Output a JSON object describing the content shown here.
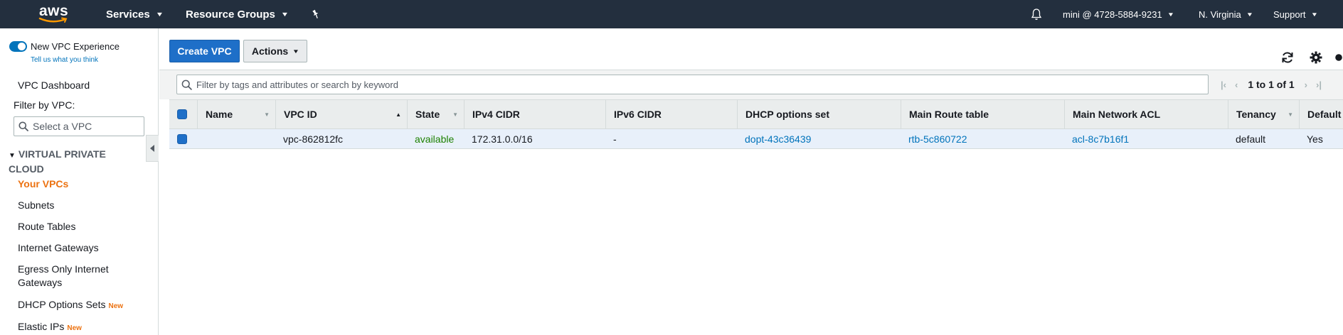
{
  "topnav": {
    "logo_text": "aws",
    "services_label": "Services",
    "resource_groups_label": "Resource Groups",
    "account_label": "mini @ 4728-5884-9231",
    "region_label": "N. Virginia",
    "support_label": "Support"
  },
  "sidebar": {
    "toggle_label": "New VPC Experience",
    "feedback_label": "Tell us what you think",
    "dashboard_label": "VPC Dashboard",
    "filter_label": "Filter by VPC:",
    "filter_placeholder": "Select a VPC",
    "section_title": "VIRTUAL PRIVATE CLOUD",
    "items": [
      {
        "label": "Your VPCs",
        "active": true,
        "badge": ""
      },
      {
        "label": "Subnets",
        "active": false,
        "badge": ""
      },
      {
        "label": "Route Tables",
        "active": false,
        "badge": ""
      },
      {
        "label": "Internet Gateways",
        "active": false,
        "badge": ""
      },
      {
        "label": "Egress Only Internet Gateways",
        "active": false,
        "badge": ""
      },
      {
        "label": "DHCP Options Sets",
        "active": false,
        "badge": "New"
      },
      {
        "label": "Elastic IPs",
        "active": false,
        "badge": "New"
      }
    ]
  },
  "toolbar": {
    "create_label": "Create VPC",
    "actions_label": "Actions"
  },
  "filter": {
    "placeholder": "Filter by tags and attributes or search by keyword",
    "pagination": "1 to 1 of 1"
  },
  "table": {
    "columns": [
      "Name",
      "VPC ID",
      "State",
      "IPv4 CIDR",
      "IPv6 CIDR",
      "DHCP options set",
      "Main Route table",
      "Main Network ACL",
      "Tenancy",
      "Default"
    ],
    "rows": [
      {
        "name": "",
        "vpc_id": "vpc-862812fc",
        "state": "available",
        "ipv4_cidr": "172.31.0.0/16",
        "ipv6_cidr": "-",
        "dhcp_options": "dopt-43c36439",
        "route_table": "rtb-5c860722",
        "network_acl": "acl-8c7b16f1",
        "tenancy": "default",
        "default": "Yes"
      }
    ]
  },
  "colors": {
    "nav_bg": "#232f3e",
    "primary": "#1e6fc8",
    "link": "#0073bb",
    "active": "#ec7211",
    "available": "#1d8102",
    "selected_row": "#e8f0fa"
  }
}
